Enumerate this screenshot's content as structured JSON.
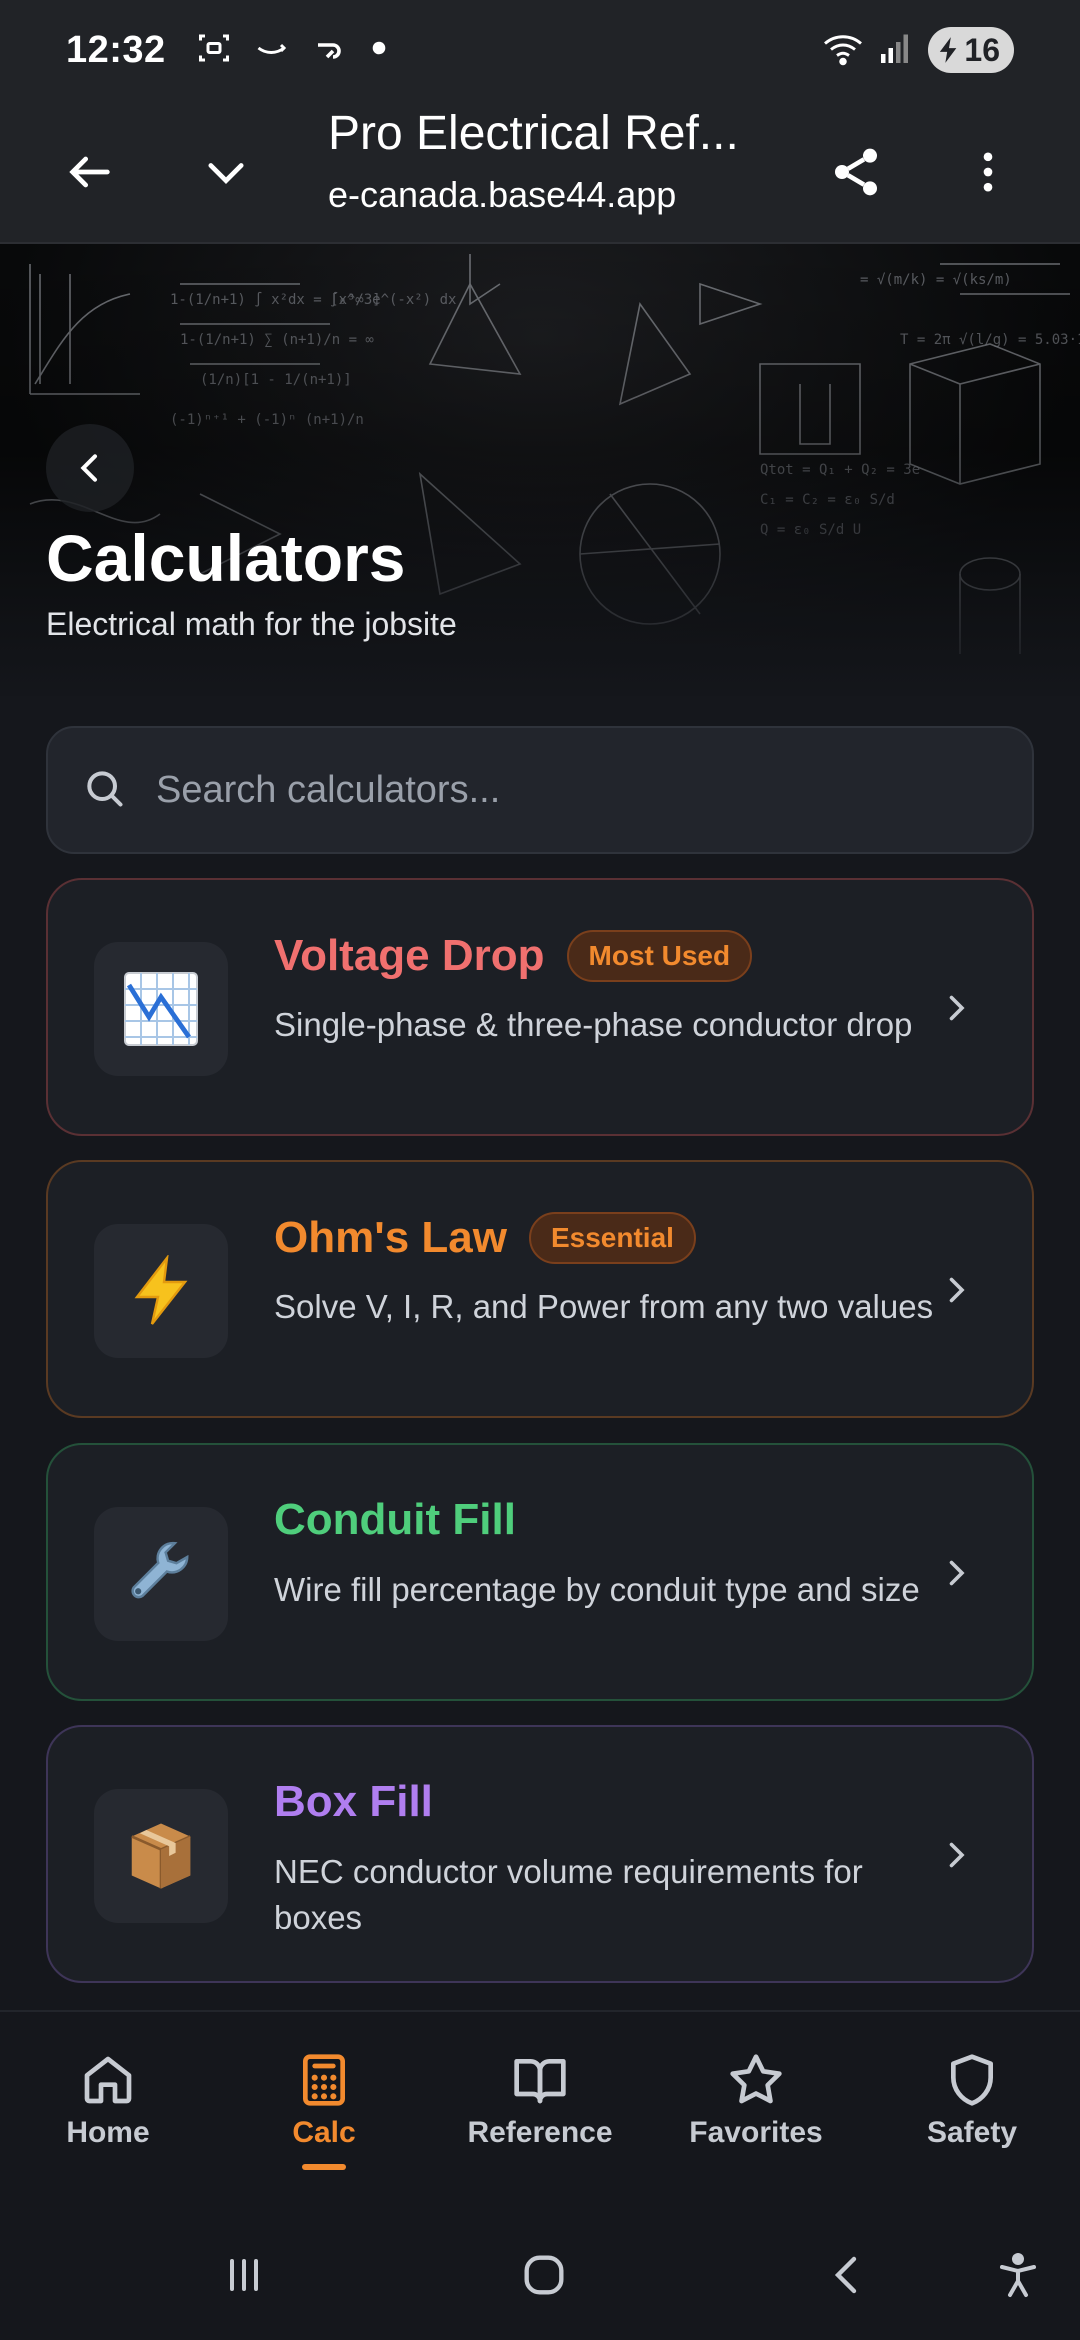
{
  "status_bar": {
    "time": "12:32",
    "battery_level": "16",
    "icons": [
      "screenshot-icon",
      "amazon-icon",
      "notification-icon",
      "dot-icon",
      "wifi-icon",
      "signal-icon",
      "battery-icon"
    ]
  },
  "browser": {
    "title": "Pro Electrical Ref...",
    "url": "e-canada.base44.app",
    "icons": [
      "back-arrow-icon",
      "chevron-down-icon",
      "share-icon",
      "more-vert-icon"
    ]
  },
  "hero": {
    "title": "Calculators",
    "subtitle": "Electrical math for the jobsite"
  },
  "search": {
    "placeholder": "Search calculators..."
  },
  "calculators": [
    {
      "title": "Voltage Drop",
      "badge": "Most Used",
      "description": "Single-phase & three-phase conductor drop",
      "icon": "chart-decreasing-icon",
      "accent": "#f0706f",
      "border": "#5a3034",
      "badge_text": "#f28a2e",
      "badge_bg": "#4a2a18"
    },
    {
      "title": "Ohm's Law",
      "badge": "Essential",
      "description": "Solve V, I, R, and Power from any two values",
      "icon": "lightning-icon",
      "accent": "#f28a2e",
      "border": "#5a3a22",
      "badge_text": "#f28a2e",
      "badge_bg": "#4a2a18"
    },
    {
      "title": "Conduit Fill",
      "badge": "",
      "description": "Wire fill percentage by conduit type and size",
      "icon": "wrench-icon",
      "accent": "#4fce7c",
      "border": "#24513a",
      "badge_text": "",
      "badge_bg": ""
    },
    {
      "title": "Box Fill",
      "badge": "",
      "description": "NEC conductor volume requirements for boxes",
      "icon": "package-icon",
      "accent": "#b07ef0",
      "border": "#3e3558",
      "badge_text": "",
      "badge_bg": ""
    }
  ],
  "bottom_nav": {
    "items": [
      {
        "label": "Home",
        "icon": "home-icon",
        "active": false
      },
      {
        "label": "Calc",
        "icon": "calculator-icon",
        "active": true
      },
      {
        "label": "Reference",
        "icon": "book-icon",
        "active": false
      },
      {
        "label": "Favorites",
        "icon": "star-icon",
        "active": false
      },
      {
        "label": "Safety",
        "icon": "shield-icon",
        "active": false
      }
    ],
    "active_color": "#f28a2e"
  },
  "system_nav": {
    "icons": [
      "recents-icon",
      "home-circle-icon",
      "back-icon",
      "accessibility-icon"
    ]
  }
}
